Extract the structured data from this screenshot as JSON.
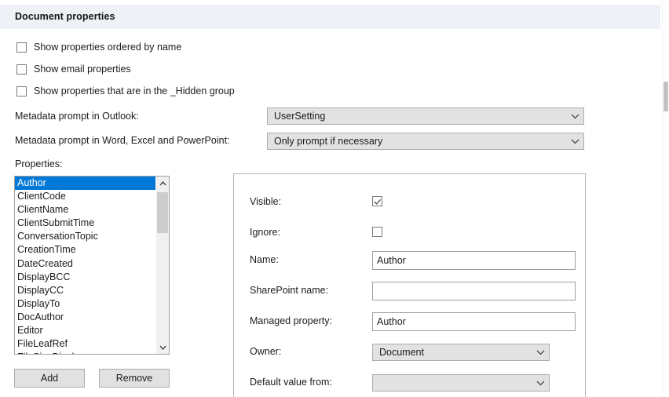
{
  "header": {
    "title": "Document properties"
  },
  "options": [
    {
      "label": "Show properties ordered by name",
      "checked": false
    },
    {
      "label": "Show email properties",
      "checked": false
    },
    {
      "label": "Show properties that are in the _Hidden group",
      "checked": false
    }
  ],
  "metadata_prompts": [
    {
      "label": "Metadata prompt in Outlook:",
      "value": "UserSetting"
    },
    {
      "label": "Metadata prompt in Word, Excel and PowerPoint:",
      "value": "Only prompt if necessary"
    }
  ],
  "properties": {
    "label": "Properties:",
    "selected": "Author",
    "items": [
      "Author",
      "ClientCode",
      "ClientName",
      "ClientSubmitTime",
      "ConversationTopic",
      "CreationTime",
      "DateCreated",
      "DisplayBCC",
      "DisplayCC",
      "DisplayTo",
      "DocAuthor",
      "Editor",
      "FileLeafRef",
      "FileSizeDisplay"
    ],
    "add_label": "Add",
    "remove_label": "Remove"
  },
  "detail": {
    "visible": {
      "label": "Visible:",
      "checked": true
    },
    "ignore": {
      "label": "Ignore:",
      "checked": false
    },
    "name": {
      "label": "Name:",
      "value": "Author",
      "placeholder": ""
    },
    "sharepoint_name": {
      "label": "SharePoint name:",
      "value": "",
      "placeholder": ""
    },
    "managed_property": {
      "label": "Managed property:",
      "value": "Author",
      "placeholder": ""
    },
    "owner": {
      "label": "Owner:",
      "value": "Document"
    },
    "default_value_from": {
      "label": "Default value from:",
      "value": ""
    }
  },
  "colors": {
    "header_band": "#eef1f5",
    "selection_blue": "#0078d7",
    "control_gray": "#e2e2e2",
    "border_gray": "#a0a0a0"
  }
}
